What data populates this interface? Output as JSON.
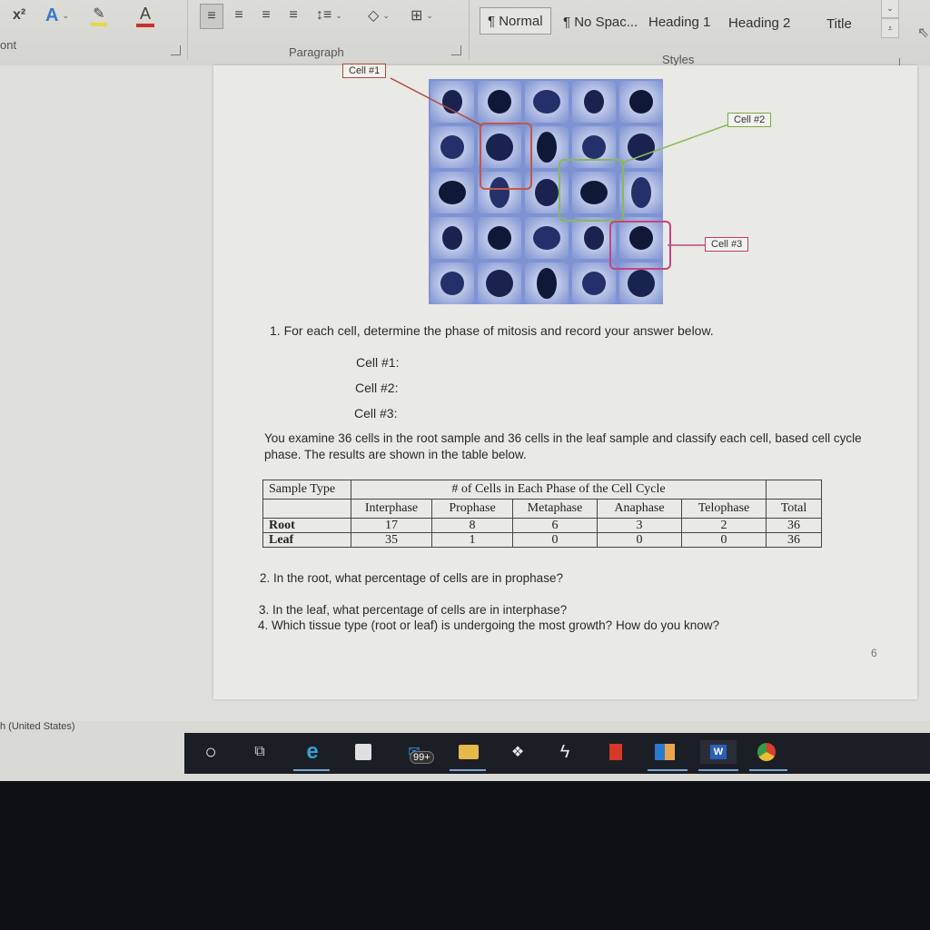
{
  "ribbon": {
    "font_group_label": "ont",
    "paragraph_group_label": "Paragraph",
    "styles_group_label": "Styles",
    "font_buttons": [
      {
        "name": "superscript",
        "glyph": "x²"
      },
      {
        "name": "text-effects",
        "glyph": "A"
      },
      {
        "name": "highlight",
        "glyph": "✎"
      },
      {
        "name": "font-color",
        "glyph": "A"
      }
    ],
    "paragraph_buttons": [
      {
        "name": "align-left",
        "glyph": "≡"
      },
      {
        "name": "align-center",
        "glyph": "≡"
      },
      {
        "name": "align-right",
        "glyph": "≡"
      },
      {
        "name": "justify",
        "glyph": "≡"
      },
      {
        "name": "line-spacing",
        "glyph": "↕≡"
      },
      {
        "name": "shading",
        "glyph": "◇"
      },
      {
        "name": "borders",
        "glyph": "⊞"
      }
    ],
    "styles": [
      {
        "label": "¶ Normal",
        "active": true
      },
      {
        "label": "¶ No Spac...",
        "active": false
      },
      {
        "label": "Heading 1",
        "active": false
      },
      {
        "label": "Heading 2",
        "active": false
      },
      {
        "label": "Title",
        "active": false
      }
    ],
    "colors": {
      "highlight": "#e6d64a",
      "font_color": "#c8302c",
      "text_effects": "#3a78c8"
    }
  },
  "figure": {
    "labels": [
      {
        "text": "Cell #1",
        "color": "#b04a3c"
      },
      {
        "text": "Cell #2",
        "color": "#7aa84a"
      },
      {
        "text": "Cell #3",
        "color": "#c03a6a"
      }
    ]
  },
  "document": {
    "question1": "1. For each cell, determine the phase of mitosis and record your answer below.",
    "answers": [
      "Cell #1:",
      "Cell #2:",
      "Cell #3:"
    ],
    "intro_line1": "You examine 36 cells in the root sample and 36 cells in the leaf sample and classify each cell, based cell cycle",
    "intro_line2": "phase. The results are shown in the table below.",
    "table": {
      "corner_header": "Sample Type",
      "group_header": "# of Cells in Each Phase of the Cell Cycle",
      "columns": [
        "Interphase",
        "Prophase",
        "Metaphase",
        "Anaphase",
        "Telophase",
        "Total"
      ],
      "rows": [
        {
          "label": "Root",
          "values": [
            "17",
            "8",
            "6",
            "3",
            "2",
            "36"
          ]
        },
        {
          "label": "Leaf",
          "values": [
            "35",
            "1",
            "0",
            "0",
            "0",
            "36"
          ]
        }
      ]
    },
    "question2": "2. In the root, what percentage of cells are in prophase?",
    "question3": "3. In the leaf, what percentage of cells are in interphase?",
    "question4": "4. Which tissue type (root or leaf) is undergoing the most growth? How do you know?",
    "page_number": "6"
  },
  "status_bar": {
    "language": "h (United States)"
  },
  "taskbar": {
    "items": [
      {
        "name": "cortana-icon",
        "glyph": "○",
        "color": "#e8e8e8",
        "running": false
      },
      {
        "name": "task-view-icon",
        "glyph": "⧉",
        "color": "#cfcfcf",
        "running": false
      },
      {
        "name": "edge-icon",
        "glyph": "e",
        "color": "#2fa3d8",
        "running": true
      },
      {
        "name": "store-icon",
        "glyph": "🛍",
        "color": "#e8e8e8",
        "running": false
      },
      {
        "name": "mail-icon",
        "glyph": "✉",
        "color": "#3a86d0",
        "running": false,
        "badge": "99+"
      },
      {
        "name": "file-explorer-icon",
        "glyph": "📁",
        "color": "#e8b84a",
        "running": true
      },
      {
        "name": "dropbox-icon",
        "glyph": "❖",
        "color": "#e8e8e8",
        "running": false
      },
      {
        "name": "app-s-icon",
        "glyph": "ϟ",
        "color": "#e8e8e8",
        "running": false
      },
      {
        "name": "office-icon",
        "glyph": "■",
        "color": "#d8382c",
        "running": false
      },
      {
        "name": "outlook-icon",
        "glyph": "✉",
        "color": "#2a7ad0",
        "running": true
      },
      {
        "name": "word-icon",
        "glyph": "W",
        "color": "#2b5fb8",
        "running": true
      },
      {
        "name": "chrome-icon",
        "glyph": "◉",
        "color": "#e0a030",
        "running": true
      }
    ]
  }
}
